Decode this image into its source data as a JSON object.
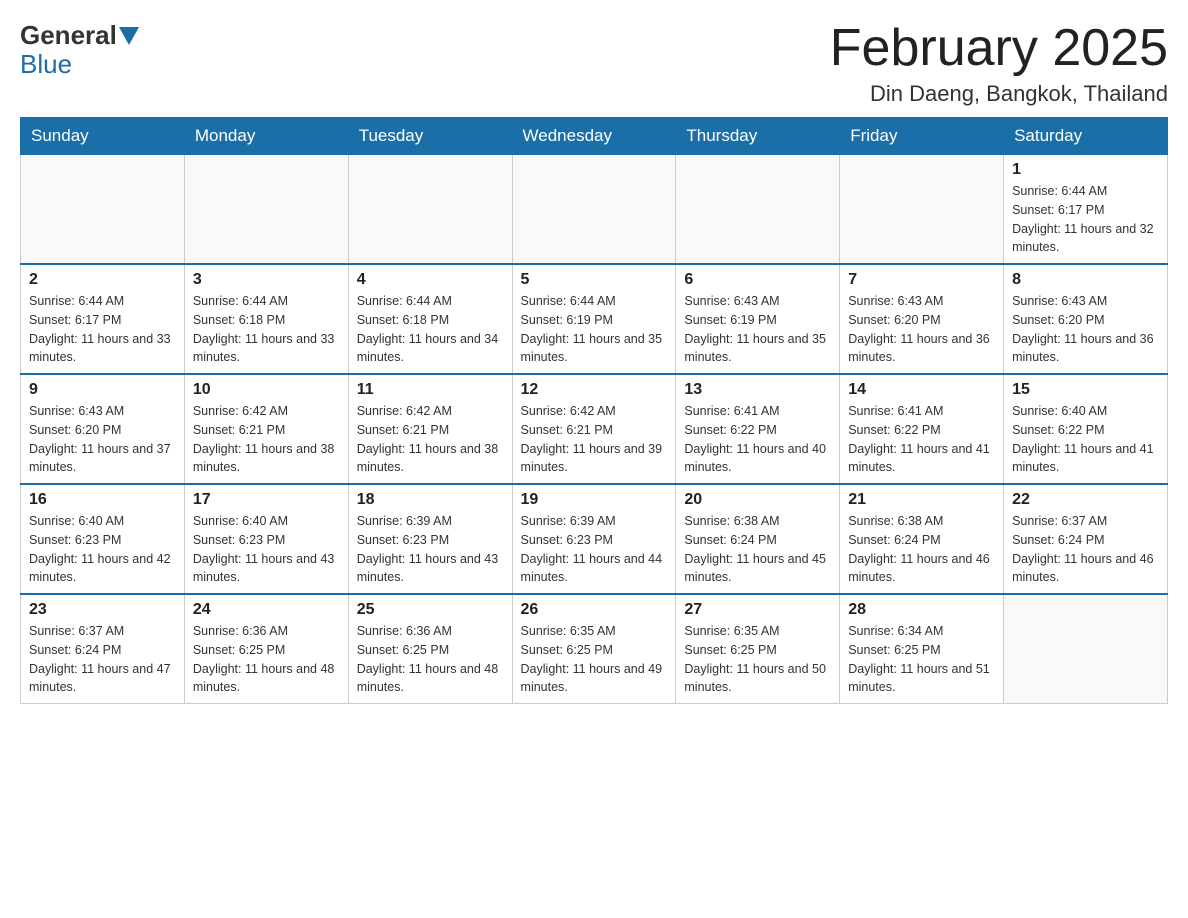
{
  "header": {
    "logo_general": "General",
    "logo_blue": "Blue",
    "month_title": "February 2025",
    "location": "Din Daeng, Bangkok, Thailand"
  },
  "weekdays": [
    "Sunday",
    "Monday",
    "Tuesday",
    "Wednesday",
    "Thursday",
    "Friday",
    "Saturday"
  ],
  "weeks": [
    [
      {
        "day": "",
        "empty": true
      },
      {
        "day": "",
        "empty": true
      },
      {
        "day": "",
        "empty": true
      },
      {
        "day": "",
        "empty": true
      },
      {
        "day": "",
        "empty": true
      },
      {
        "day": "",
        "empty": true
      },
      {
        "day": "1",
        "sunrise": "6:44 AM",
        "sunset": "6:17 PM",
        "daylight": "11 hours and 32 minutes."
      }
    ],
    [
      {
        "day": "2",
        "sunrise": "6:44 AM",
        "sunset": "6:17 PM",
        "daylight": "11 hours and 33 minutes."
      },
      {
        "day": "3",
        "sunrise": "6:44 AM",
        "sunset": "6:18 PM",
        "daylight": "11 hours and 33 minutes."
      },
      {
        "day": "4",
        "sunrise": "6:44 AM",
        "sunset": "6:18 PM",
        "daylight": "11 hours and 34 minutes."
      },
      {
        "day": "5",
        "sunrise": "6:44 AM",
        "sunset": "6:19 PM",
        "daylight": "11 hours and 35 minutes."
      },
      {
        "day": "6",
        "sunrise": "6:43 AM",
        "sunset": "6:19 PM",
        "daylight": "11 hours and 35 minutes."
      },
      {
        "day": "7",
        "sunrise": "6:43 AM",
        "sunset": "6:20 PM",
        "daylight": "11 hours and 36 minutes."
      },
      {
        "day": "8",
        "sunrise": "6:43 AM",
        "sunset": "6:20 PM",
        "daylight": "11 hours and 36 minutes."
      }
    ],
    [
      {
        "day": "9",
        "sunrise": "6:43 AM",
        "sunset": "6:20 PM",
        "daylight": "11 hours and 37 minutes."
      },
      {
        "day": "10",
        "sunrise": "6:42 AM",
        "sunset": "6:21 PM",
        "daylight": "11 hours and 38 minutes."
      },
      {
        "day": "11",
        "sunrise": "6:42 AM",
        "sunset": "6:21 PM",
        "daylight": "11 hours and 38 minutes."
      },
      {
        "day": "12",
        "sunrise": "6:42 AM",
        "sunset": "6:21 PM",
        "daylight": "11 hours and 39 minutes."
      },
      {
        "day": "13",
        "sunrise": "6:41 AM",
        "sunset": "6:22 PM",
        "daylight": "11 hours and 40 minutes."
      },
      {
        "day": "14",
        "sunrise": "6:41 AM",
        "sunset": "6:22 PM",
        "daylight": "11 hours and 41 minutes."
      },
      {
        "day": "15",
        "sunrise": "6:40 AM",
        "sunset": "6:22 PM",
        "daylight": "11 hours and 41 minutes."
      }
    ],
    [
      {
        "day": "16",
        "sunrise": "6:40 AM",
        "sunset": "6:23 PM",
        "daylight": "11 hours and 42 minutes."
      },
      {
        "day": "17",
        "sunrise": "6:40 AM",
        "sunset": "6:23 PM",
        "daylight": "11 hours and 43 minutes."
      },
      {
        "day": "18",
        "sunrise": "6:39 AM",
        "sunset": "6:23 PM",
        "daylight": "11 hours and 43 minutes."
      },
      {
        "day": "19",
        "sunrise": "6:39 AM",
        "sunset": "6:23 PM",
        "daylight": "11 hours and 44 minutes."
      },
      {
        "day": "20",
        "sunrise": "6:38 AM",
        "sunset": "6:24 PM",
        "daylight": "11 hours and 45 minutes."
      },
      {
        "day": "21",
        "sunrise": "6:38 AM",
        "sunset": "6:24 PM",
        "daylight": "11 hours and 46 minutes."
      },
      {
        "day": "22",
        "sunrise": "6:37 AM",
        "sunset": "6:24 PM",
        "daylight": "11 hours and 46 minutes."
      }
    ],
    [
      {
        "day": "23",
        "sunrise": "6:37 AM",
        "sunset": "6:24 PM",
        "daylight": "11 hours and 47 minutes."
      },
      {
        "day": "24",
        "sunrise": "6:36 AM",
        "sunset": "6:25 PM",
        "daylight": "11 hours and 48 minutes."
      },
      {
        "day": "25",
        "sunrise": "6:36 AM",
        "sunset": "6:25 PM",
        "daylight": "11 hours and 48 minutes."
      },
      {
        "day": "26",
        "sunrise": "6:35 AM",
        "sunset": "6:25 PM",
        "daylight": "11 hours and 49 minutes."
      },
      {
        "day": "27",
        "sunrise": "6:35 AM",
        "sunset": "6:25 PM",
        "daylight": "11 hours and 50 minutes."
      },
      {
        "day": "28",
        "sunrise": "6:34 AM",
        "sunset": "6:25 PM",
        "daylight": "11 hours and 51 minutes."
      },
      {
        "day": "",
        "empty": true
      }
    ]
  ]
}
